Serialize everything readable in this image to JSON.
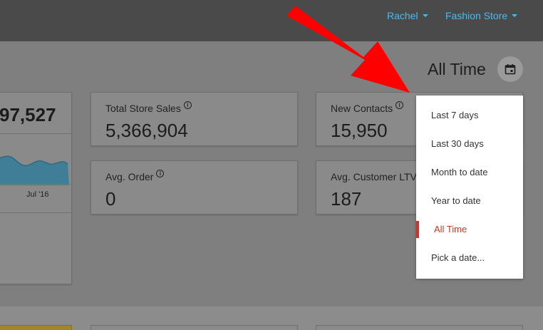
{
  "topbar": {
    "user_menu": "Rachel",
    "store_menu": "Fashion Store"
  },
  "date_range": {
    "label": "All Time",
    "calendar_icon": "calendar-icon"
  },
  "cards": {
    "partial_total": "97,527",
    "chart_axis_label": "Jul '16",
    "total_store_sales": {
      "label": "Total Store Sales",
      "value": "5,366,904"
    },
    "new_contacts": {
      "label": "New Contacts",
      "value": "15,950"
    },
    "avg_order": {
      "label": "Avg. Order",
      "value": "0"
    },
    "avg_customer_ltv": {
      "label": "Avg. Customer LTV",
      "value": "187"
    }
  },
  "dropdown": {
    "items": [
      {
        "label": "Last 7 days",
        "active": false
      },
      {
        "label": "Last 30 days",
        "active": false
      },
      {
        "label": "Month to date",
        "active": false
      },
      {
        "label": "Year to date",
        "active": false
      },
      {
        "label": "All Time",
        "active": true
      },
      {
        "label": "Pick a date...",
        "active": false
      }
    ]
  },
  "colors": {
    "accent_link": "#4db8f0",
    "active_item": "#d0312d",
    "annotation_arrow": "#ff0000"
  }
}
